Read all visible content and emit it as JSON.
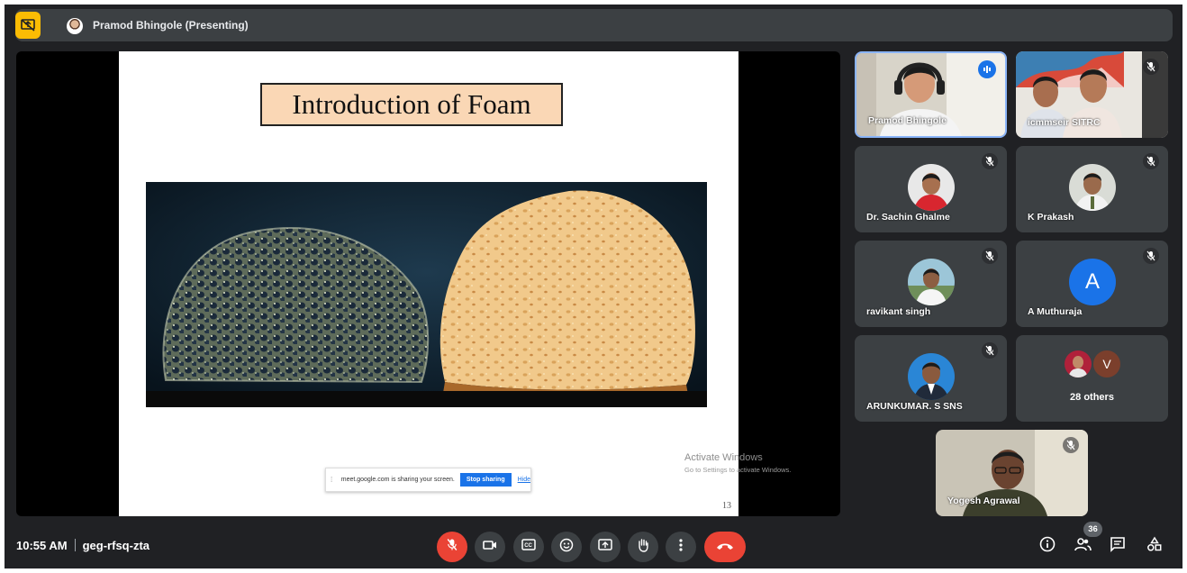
{
  "topbar": {
    "presenter_title": "Pramod Bhingole (Presenting)"
  },
  "slide": {
    "title": "Introduction of Foam",
    "page_number": "13",
    "share_notice": {
      "text": "meet.google.com is sharing your screen.",
      "stop_label": "Stop sharing",
      "hide_label": "Hide"
    }
  },
  "watermark": {
    "line1": "Activate Windows",
    "line2": "Go to Settings to activate Windows."
  },
  "participants": [
    {
      "name": "Pramod Bhingole",
      "speaking": true
    },
    {
      "name": "icmmseir SITRC",
      "muted": true
    },
    {
      "name": "Dr. Sachin Ghalme",
      "muted": true
    },
    {
      "name": "K Prakash",
      "muted": true
    },
    {
      "name": "ravikant singh",
      "muted": true
    },
    {
      "name": "A Muthuraja",
      "muted": true,
      "initial": "A",
      "color": "#1a73e8"
    },
    {
      "name": "ARUNKUMAR. S SNS",
      "muted": true
    },
    {
      "others_label": "28 others",
      "initial": "V",
      "color": "#7b3f2c"
    },
    {
      "name": "Yogesh Agrawal",
      "muted": true
    }
  ],
  "bottom": {
    "time": "10:55 AM",
    "meeting_code": "geg-rfsq-zta",
    "people_count": "36"
  },
  "colors": {
    "accent": "#1a73e8",
    "danger": "#ea4335",
    "presenting": "#fbbc04"
  }
}
